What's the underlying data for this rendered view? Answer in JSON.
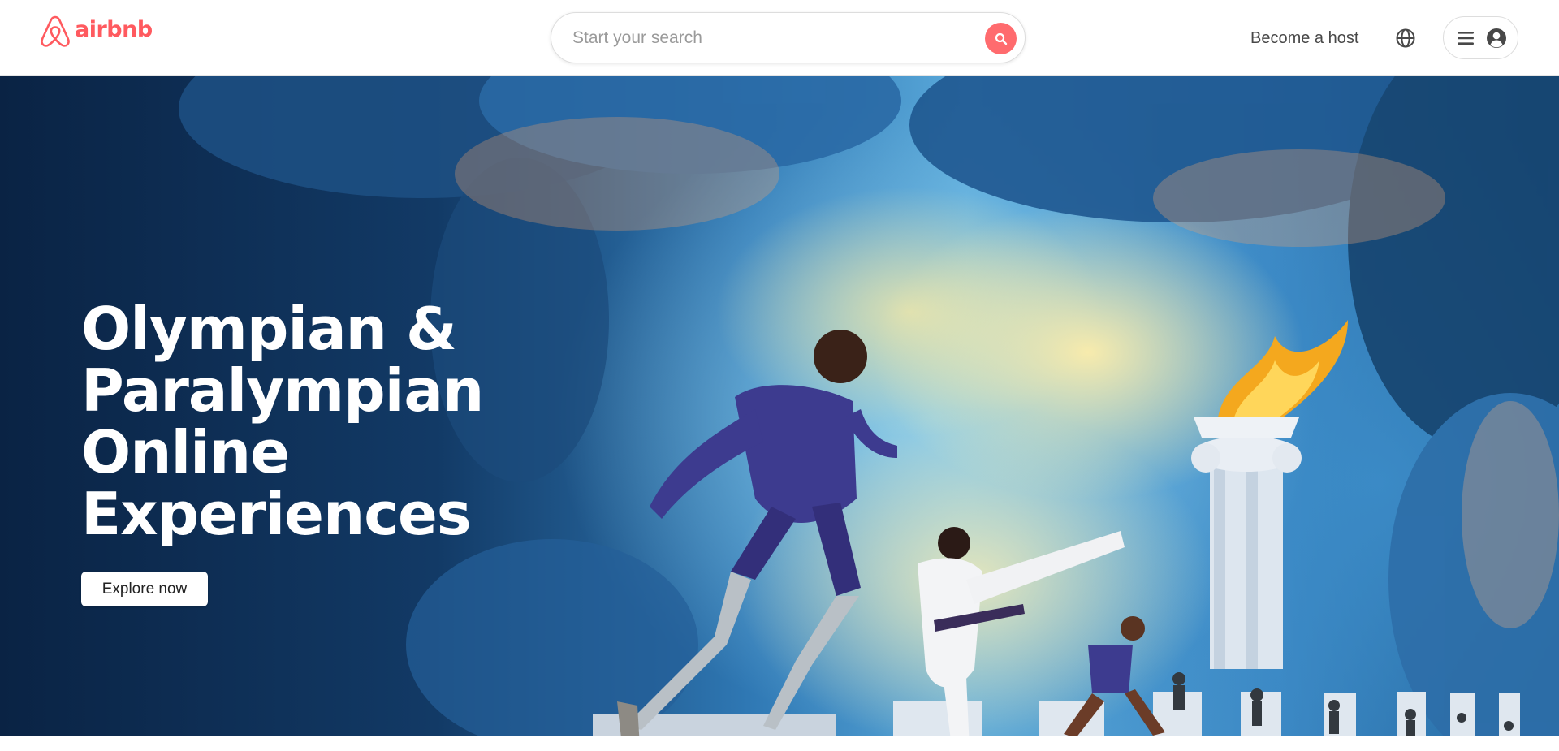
{
  "header": {
    "logo_text": "airbnb",
    "search": {
      "placeholder": "Start your search",
      "value": ""
    },
    "host_link": "Become a host",
    "icons": [
      "airbnb-logo-icon",
      "search-icon",
      "globe-icon",
      "menu-icon",
      "user-avatar-icon"
    ]
  },
  "hero": {
    "title_lines": [
      "Olympian &",
      "Paralympian",
      "Online",
      "Experiences"
    ],
    "cta_label": "Explore now"
  },
  "colors": {
    "brand": "#ff5a5f",
    "search_button": "#ff6b6e",
    "text_dark": "#222222",
    "text_muted": "#484848",
    "hero_text": "#ffffff"
  }
}
